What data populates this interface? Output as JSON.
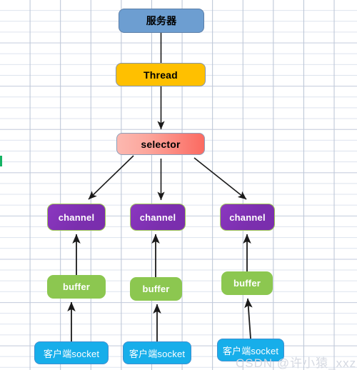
{
  "diagram": {
    "title": "NIO server architecture diagram",
    "background": "spreadsheet-grid",
    "nodes": {
      "server": {
        "label": "服务器",
        "color": "#6d9ed1",
        "border": "#5b7ea8",
        "text_color": "#000000"
      },
      "thread": {
        "label": "Thread",
        "color": "#ffc000",
        "border": "#8596ad",
        "text_color": "#000000"
      },
      "selector": {
        "label": "selector",
        "color_start": "#fcb8b0",
        "color_end": "#fb6a61",
        "border": "#8ba0bb",
        "text_color": "#000000"
      },
      "channels": [
        {
          "label": "channel",
          "color": "#7b2fae",
          "border": "#9fc857",
          "text_color": "#ffffff"
        },
        {
          "label": "channel",
          "color": "#7b2fae",
          "border": "#9fc857",
          "text_color": "#ffffff"
        },
        {
          "label": "channel",
          "color": "#7b2fae",
          "border": "#9fc857",
          "text_color": "#ffffff"
        }
      ],
      "buffers": [
        {
          "label": "buffer",
          "color": "#8cc750",
          "text_color": "#ffffff"
        },
        {
          "label": "buffer",
          "color": "#8cc750",
          "text_color": "#ffffff"
        },
        {
          "label": "buffer",
          "color": "#8cc750",
          "text_color": "#ffffff"
        }
      ],
      "sockets": [
        {
          "label": "客户端socket",
          "color": "#17aeea",
          "border": "#3f8fd0",
          "text_color": "#ffffff"
        },
        {
          "label": "客户端socket",
          "color": "#17aeea",
          "border": "#3f8fd0",
          "text_color": "#ffffff"
        },
        {
          "label": "客户端socket",
          "color": "#17aeea",
          "border": "#3f8fd0",
          "text_color": "#ffffff"
        }
      ]
    },
    "connectors": [
      {
        "from": "server",
        "to": "thread",
        "arrow": false,
        "direction": "down"
      },
      {
        "from": "thread",
        "to": "selector",
        "arrow": true,
        "direction": "down"
      },
      {
        "from": "selector",
        "to": "channel-1",
        "arrow": true,
        "direction": "down-left"
      },
      {
        "from": "selector",
        "to": "channel-2",
        "arrow": true,
        "direction": "down"
      },
      {
        "from": "selector",
        "to": "channel-3",
        "arrow": true,
        "direction": "down-right"
      },
      {
        "from": "buffer-1",
        "to": "channel-1",
        "arrow": true,
        "direction": "up"
      },
      {
        "from": "buffer-2",
        "to": "channel-2",
        "arrow": true,
        "direction": "up"
      },
      {
        "from": "buffer-3",
        "to": "channel-3",
        "arrow": true,
        "direction": "up"
      },
      {
        "from": "socket-1",
        "to": "buffer-1",
        "arrow": true,
        "direction": "up"
      },
      {
        "from": "socket-2",
        "to": "buffer-2",
        "arrow": true,
        "direction": "up"
      },
      {
        "from": "socket-3",
        "to": "buffer-3",
        "arrow": true,
        "direction": "up"
      }
    ],
    "watermark": "CSDN @许小猿_xxz"
  }
}
